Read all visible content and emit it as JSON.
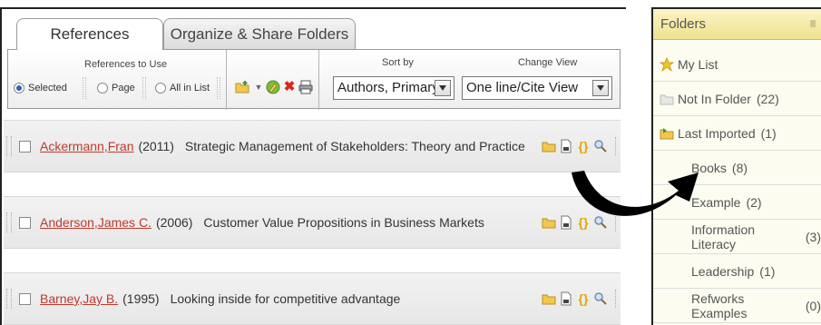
{
  "tabs": {
    "references": "References",
    "organize": "Organize & Share Folders"
  },
  "toolbar": {
    "refs_to_use_label": "References to Use",
    "radio_selected": "Selected",
    "radio_page": "Page",
    "radio_all": "All in List",
    "sort_label": "Sort by",
    "sort_value": "Authors, Primary",
    "view_label": "Change View",
    "view_value": "One line/Cite View"
  },
  "references": [
    {
      "author": "Ackermann,Fran",
      "year": "(2011)",
      "title": "Strategic Management of Stakeholders: Theory and Practice"
    },
    {
      "author": "Anderson,James C.",
      "year": "(2006)",
      "title": "Customer Value Propositions in Business Markets"
    },
    {
      "author": "Barney,Jay B.",
      "year": "(1995)",
      "title": "Looking inside for competitive advantage"
    }
  ],
  "folders": {
    "header": "Folders",
    "items": [
      {
        "name": "My List",
        "count": "",
        "icon": "star-icon"
      },
      {
        "name": "Not In Folder",
        "count": "(22)",
        "icon": "folder-gray-icon"
      },
      {
        "name": "Last Imported",
        "count": "(1)",
        "icon": "folder-import-icon"
      },
      {
        "name": "Books",
        "count": "(8)",
        "icon": ""
      },
      {
        "name": "Example",
        "count": "(2)",
        "icon": ""
      },
      {
        "name": "Information Literacy",
        "count": "(3)",
        "icon": ""
      },
      {
        "name": "Leadership",
        "count": "(1)",
        "icon": ""
      },
      {
        "name": "Refworks Examples",
        "count": "(0)",
        "icon": ""
      }
    ]
  },
  "colors": {
    "author_link": "#c0392b",
    "folders_header": "#efe28f",
    "radio_selected": "#2a62b8"
  }
}
